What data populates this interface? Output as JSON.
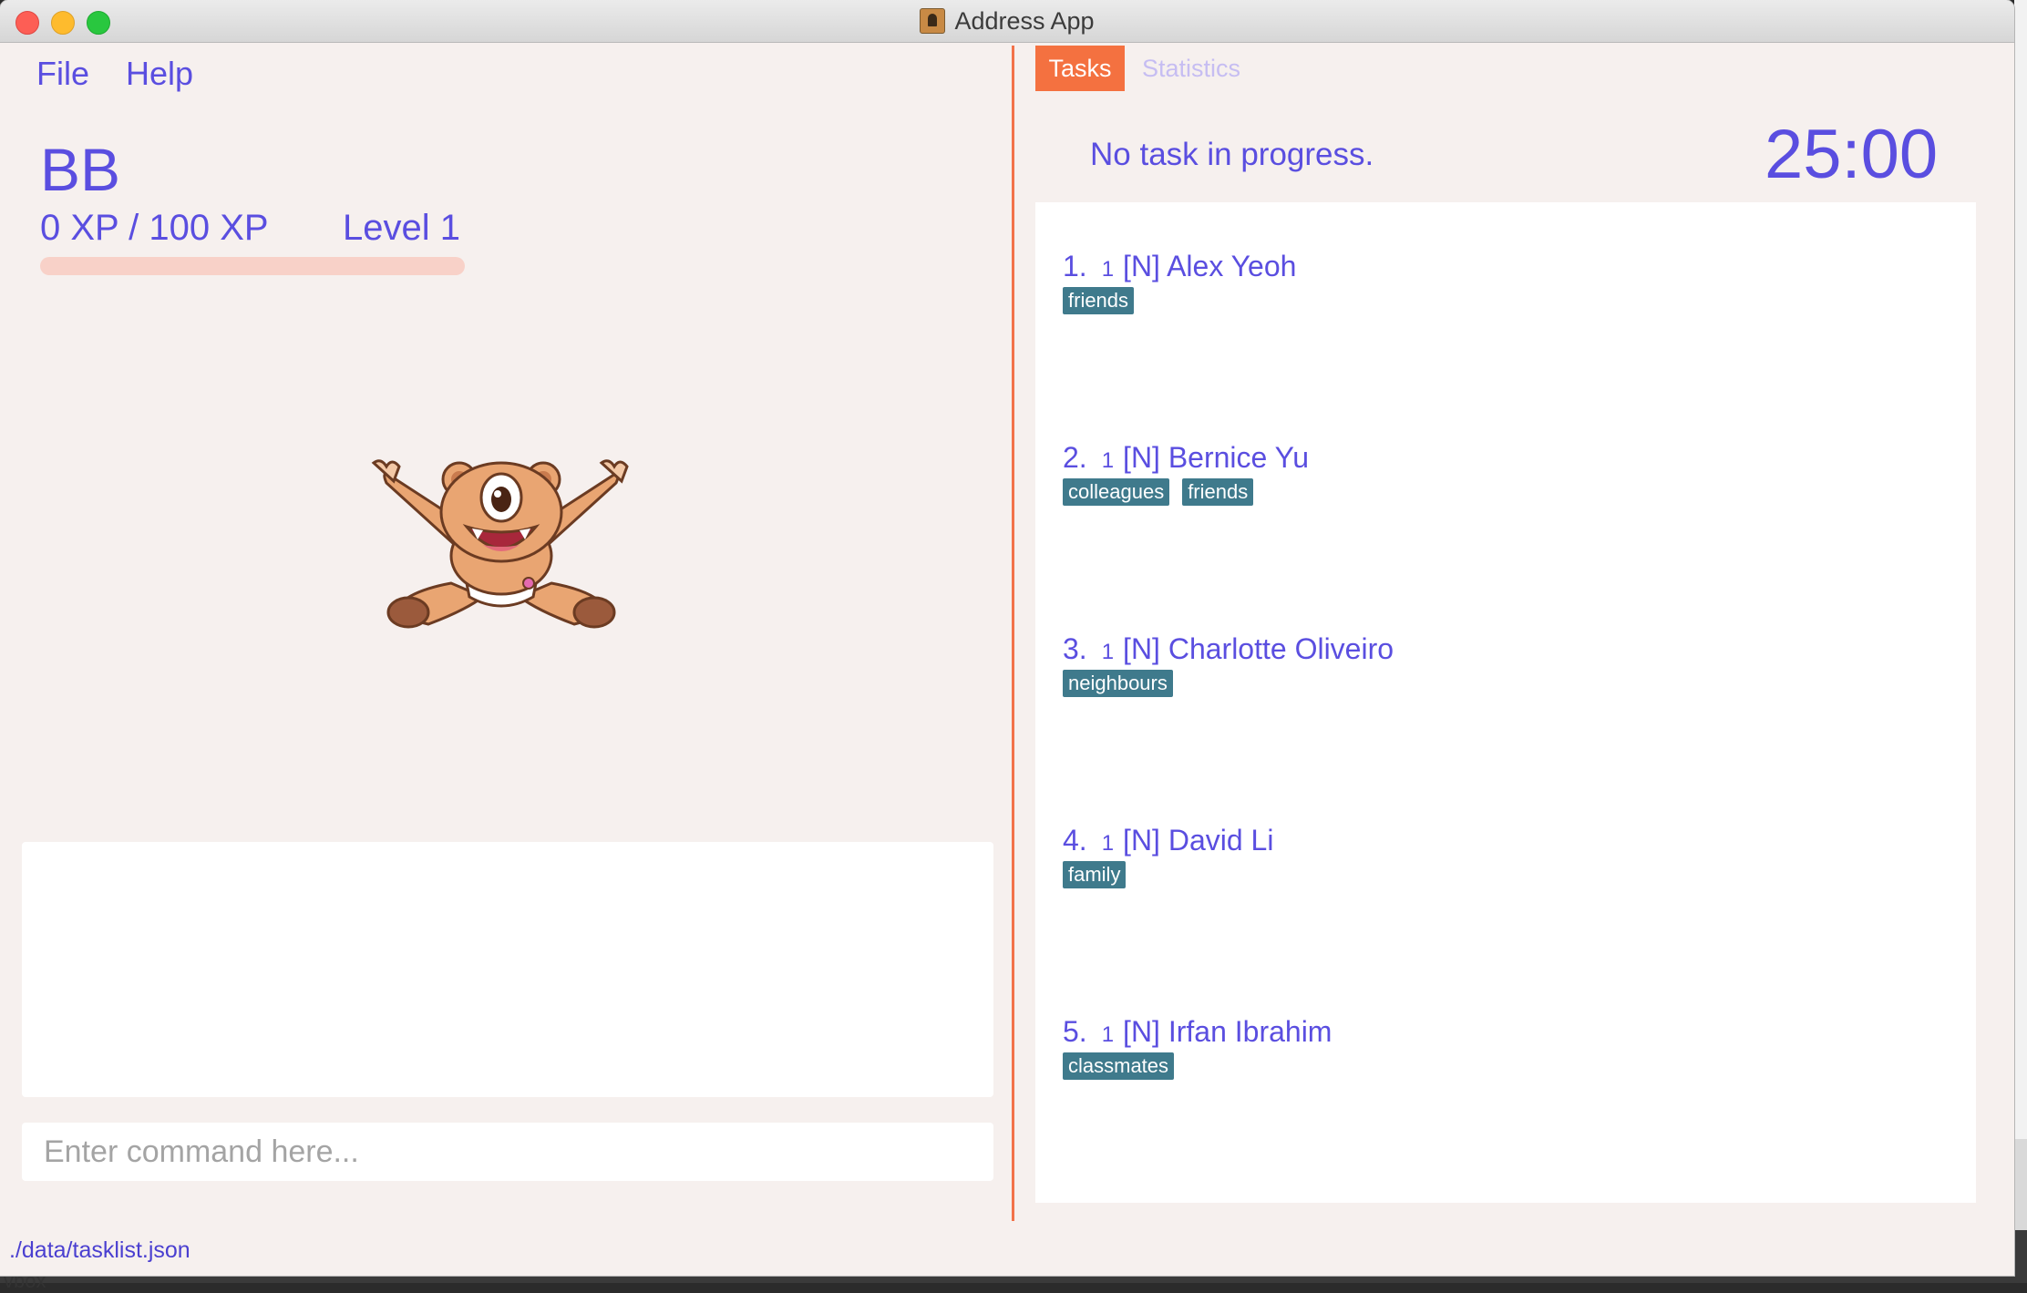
{
  "window": {
    "title": "Address App"
  },
  "menu": {
    "file": "File",
    "help": "Help"
  },
  "profile": {
    "name": "BB",
    "xp": "0 XP / 100 XP",
    "level": "Level 1",
    "xp_progress": 0
  },
  "command": {
    "placeholder": "Enter command here..."
  },
  "status_bar": {
    "path": "./data/tasklist.json"
  },
  "tabs": {
    "active": "Tasks",
    "inactive": "Statistics"
  },
  "task_status": "No task in progress.",
  "timer": "25:00",
  "tasks": [
    {
      "index": "1.",
      "priority": "1",
      "name": "[N] Alex Yeoh",
      "tags": [
        "friends"
      ]
    },
    {
      "index": "2.",
      "priority": "1",
      "name": "[N] Bernice Yu",
      "tags": [
        "colleagues",
        "friends"
      ]
    },
    {
      "index": "3.",
      "priority": "1",
      "name": "[N] Charlotte Oliveiro",
      "tags": [
        "neighbours"
      ]
    },
    {
      "index": "4.",
      "priority": "1",
      "name": "[N] David Li",
      "tags": [
        "family"
      ]
    },
    {
      "index": "5.",
      "priority": "1",
      "name": "[N] Irfan Ibrahim",
      "tags": [
        "classmates"
      ]
    }
  ],
  "colors": {
    "accent": "#5a4ee0",
    "tab_active": "#f47140",
    "tag": "#3f7a8c",
    "divider": "#f2724a"
  },
  "desktop": {
    "fragment": "vbox"
  }
}
